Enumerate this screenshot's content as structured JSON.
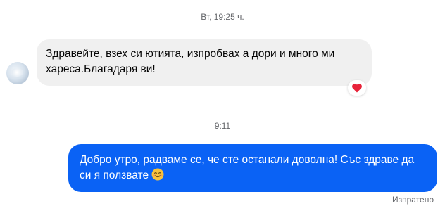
{
  "timestamps": {
    "first": "Вт, 19:25 ч.",
    "second": "9:11"
  },
  "incoming": {
    "text": "Здравейте, взех си ютията, изпробвах а дори и много ми хареса.Благадаря ви!",
    "reaction_icon": "red-heart"
  },
  "outgoing": {
    "text": "Добро утро, радваме се, че сте останали доволна! Със здраве да си я ползвате",
    "emoji_icon": "smiling-face-with-smiling-eyes",
    "accent_color": "#0a62f5"
  },
  "status": "Изпратено"
}
